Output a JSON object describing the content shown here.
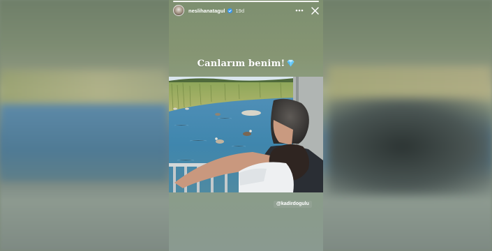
{
  "story": {
    "username": "neslihanatagul",
    "time_ago": "19d",
    "caption": "Canlarım benim!",
    "caption_emoji": "gem-stone-icon",
    "mention": "@kadirdogulu",
    "progress_fraction": 1.0
  },
  "icons": {
    "more": "more-horizontal-icon",
    "close": "close-icon",
    "verified": "verified-badge-icon"
  },
  "colors": {
    "verified_blue": "#3897f0",
    "gem_blue": "#7fd3ff",
    "text_white": "#ffffff"
  }
}
